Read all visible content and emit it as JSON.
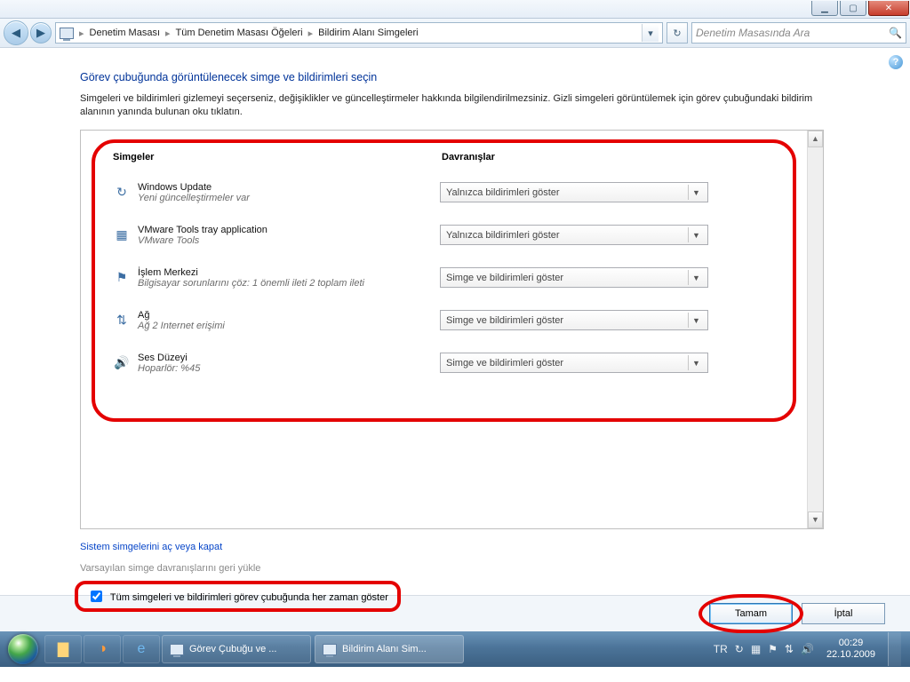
{
  "window": {
    "address": {
      "crumbs": [
        "Denetim Masası",
        "Tüm Denetim Masası Öğeleri",
        "Bildirim Alanı Simgeleri"
      ]
    },
    "search_placeholder": "Denetim Masasında Ara"
  },
  "page": {
    "heading": "Görev çubuğunda görüntülenecek simge ve bildirimleri seçin",
    "intro": "Simgeleri ve bildirimleri gizlemeyi seçerseniz, değişiklikler ve güncelleştirmeler hakkında bilgilendirilmezsiniz. Gizli simgeleri görüntülemek için görev çubuğundaki bildirim alanının yanında bulunan oku tıklatın.",
    "col_icons": "Simgeler",
    "col_behaviors": "Davranışlar",
    "rows": [
      {
        "icon": "↻",
        "title": "Windows Update",
        "sub": "Yeni güncelleştirmeler var",
        "value": "Yalnızca bildirimleri göster"
      },
      {
        "icon": "▦",
        "title": "VMware Tools tray application",
        "sub": "VMware Tools",
        "value": "Yalnızca bildirimleri göster"
      },
      {
        "icon": "⚑",
        "title": "İşlem Merkezi",
        "sub": "Bilgisayar sorunlarını çöz: 1 önemli ileti  2 toplam ileti",
        "value": "Simge ve bildirimleri göster"
      },
      {
        "icon": "⇅",
        "title": "Ağ",
        "sub": "Ağ  2 Internet erişimi",
        "value": "Simge ve bildirimleri göster"
      },
      {
        "icon": "🔊",
        "title": "Ses Düzeyi",
        "sub": "Hoparlör: %45",
        "value": "Simge ve bildirimleri göster"
      }
    ],
    "link_system_icons": "Sistem simgelerini aç veya kapat",
    "link_restore_defaults": "Varsayılan simge davranışlarını geri yükle",
    "checkbox_label": "Tüm simgeleri ve bildirimleri görev çubuğunda her zaman göster"
  },
  "footer": {
    "ok": "Tamam",
    "cancel": "İptal"
  },
  "taskbar": {
    "tasks": [
      {
        "label": "Görev Çubuğu ve ..."
      },
      {
        "label": "Bildirim Alanı Sim..."
      }
    ],
    "lang": "TR",
    "time": "00:29",
    "date": "22.10.2009"
  }
}
